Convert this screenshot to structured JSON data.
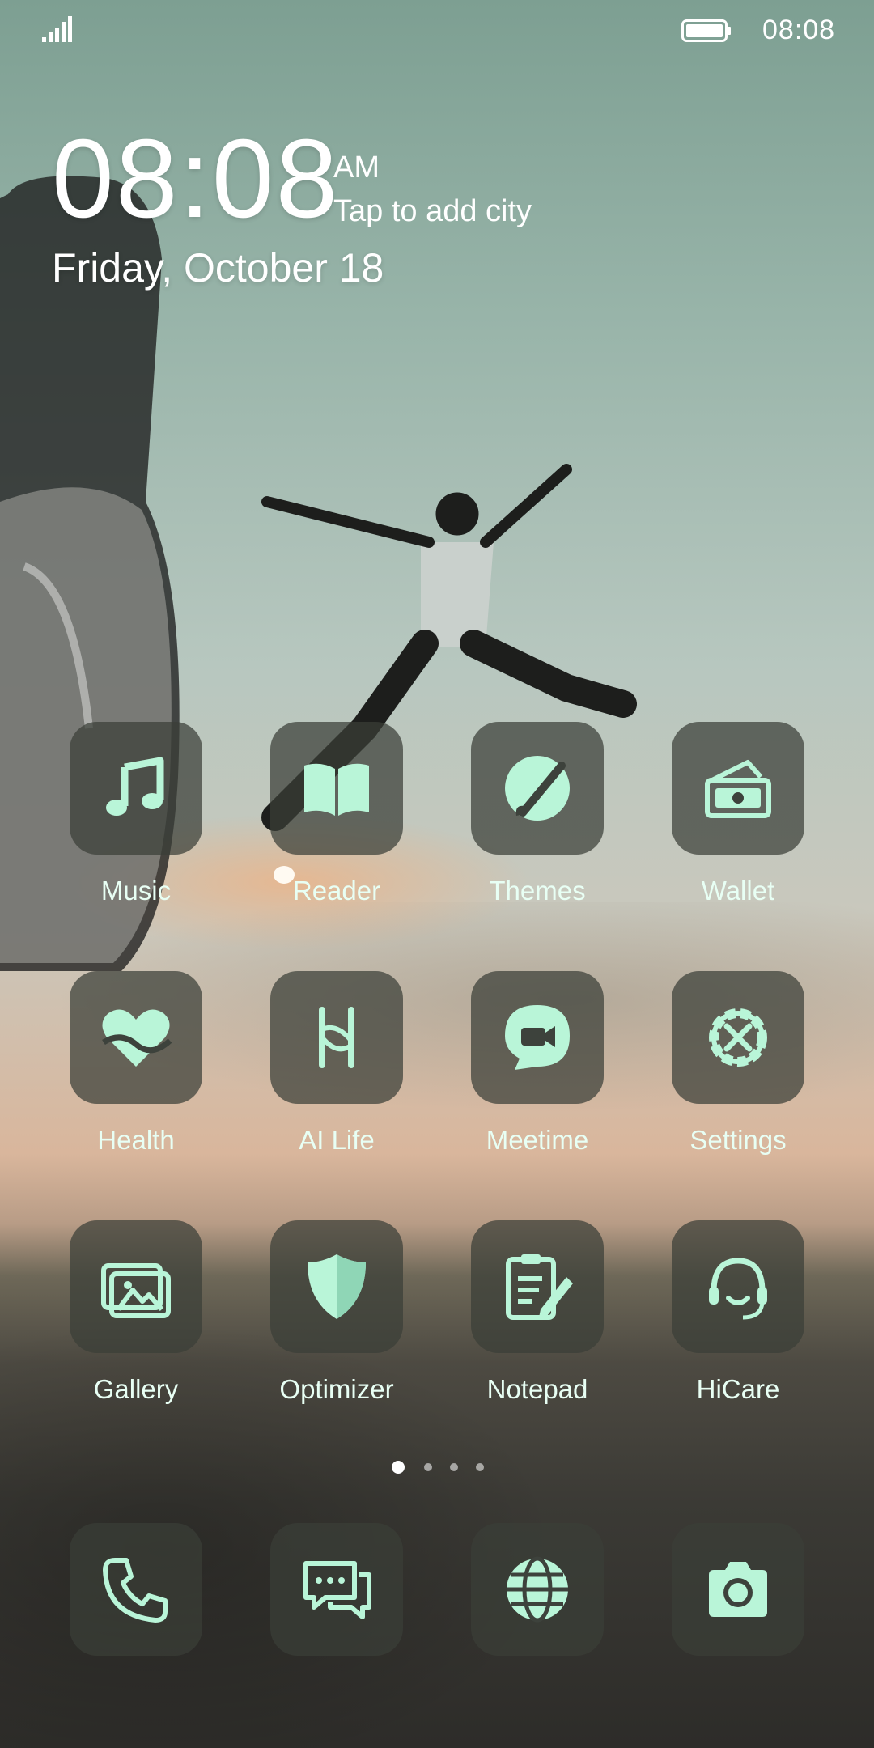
{
  "status_bar": {
    "time": "08:08",
    "signal_icon": "signal-bars-icon",
    "battery_icon": "battery-icon"
  },
  "clock": {
    "time": "08:08",
    "ampm": "AM",
    "city_prompt": "Tap to add city",
    "date": "Friday, October 18"
  },
  "apps": [
    {
      "label": "Music",
      "icon": "music-note-icon"
    },
    {
      "label": "Reader",
      "icon": "open-book-icon"
    },
    {
      "label": "Themes",
      "icon": "paint-brush-icon"
    },
    {
      "label": "Wallet",
      "icon": "wallet-icon"
    },
    {
      "label": "Health",
      "icon": "heart-icon"
    },
    {
      "label": "AI Life",
      "icon": "ai-life-icon"
    },
    {
      "label": "Meetime",
      "icon": "video-chat-icon"
    },
    {
      "label": "Settings",
      "icon": "gear-icon"
    },
    {
      "label": "Gallery",
      "icon": "gallery-icon"
    },
    {
      "label": "Optimizer",
      "icon": "shield-icon"
    },
    {
      "label": "Notepad",
      "icon": "notepad-icon"
    },
    {
      "label": "HiCare",
      "icon": "headset-icon"
    }
  ],
  "page_indicator": {
    "pages": 4,
    "active": 1
  },
  "dock": [
    {
      "icon": "phone-icon"
    },
    {
      "icon": "messages-icon"
    },
    {
      "icon": "browser-globe-icon"
    },
    {
      "icon": "camera-icon"
    }
  ],
  "icon_color": "#b9f5d8"
}
